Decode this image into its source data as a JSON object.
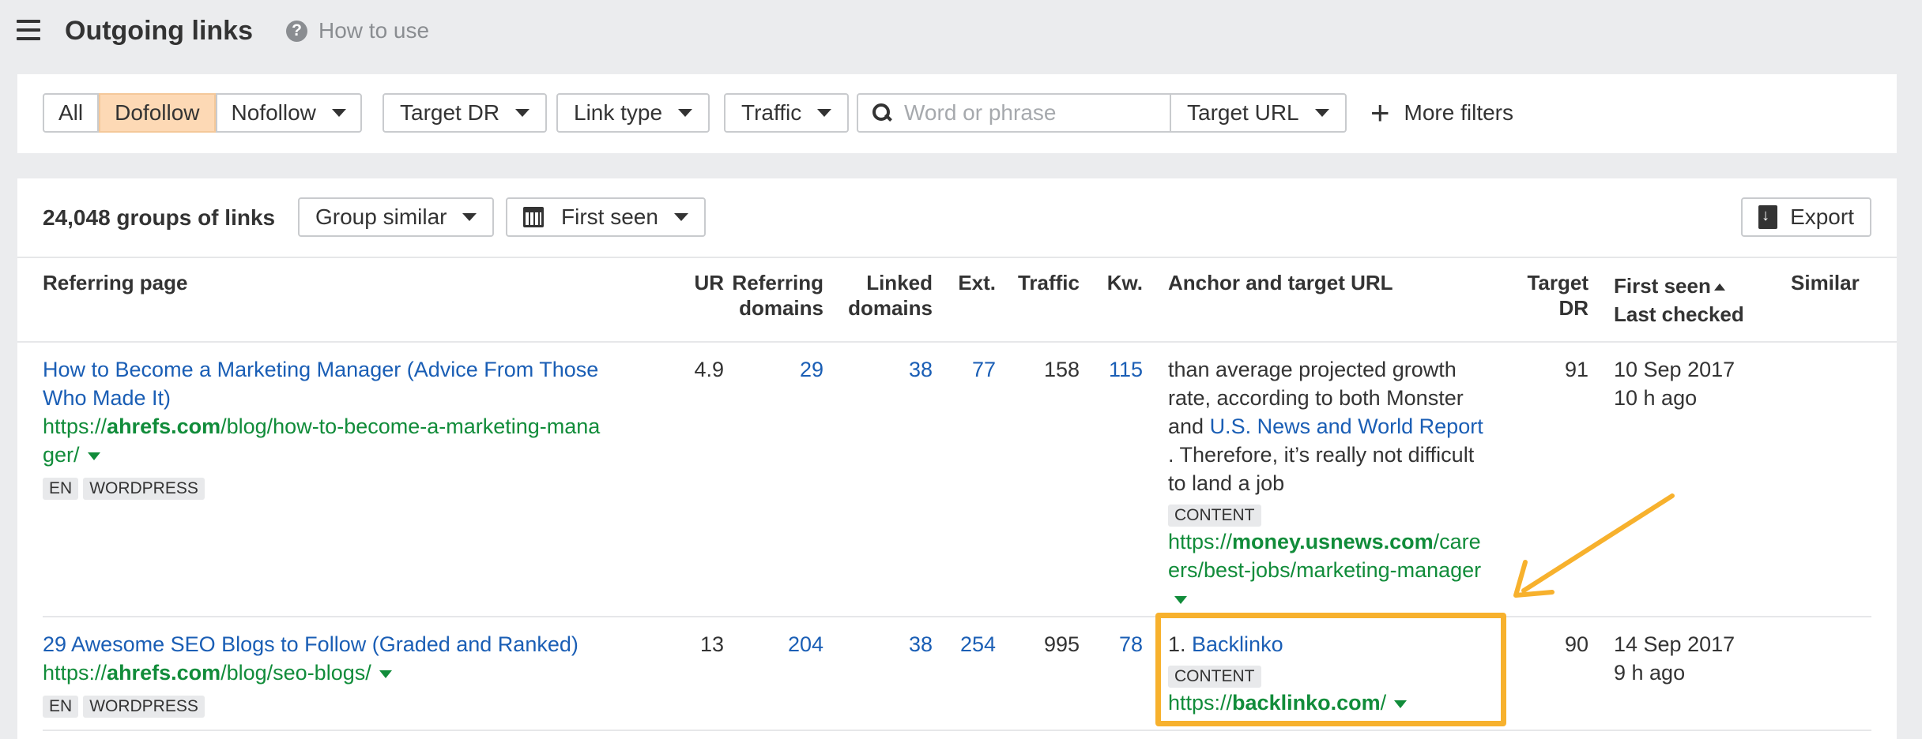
{
  "header": {
    "title": "Outgoing links",
    "howto_label": "How to use"
  },
  "filters": {
    "all": "All",
    "dofollow": "Dofollow",
    "nofollow": "Nofollow",
    "target_dr": "Target DR",
    "link_type": "Link type",
    "traffic": "Traffic",
    "search_placeholder": "Word or phrase",
    "target_url": "Target URL",
    "more_filters": "More filters"
  },
  "toolbar": {
    "groups_count": "24,048 groups of links",
    "group_similar": "Group similar",
    "first_seen": "First seen",
    "export": "Export"
  },
  "columns": {
    "referring_page": "Referring page",
    "ur": "UR",
    "referring_domains_1": "Referring",
    "referring_domains_2": "domains",
    "linked_domains_1": "Linked",
    "linked_domains_2": "domains",
    "ext": "Ext.",
    "traffic": "Traffic",
    "kw": "Kw.",
    "anchor": "Anchor and target URL",
    "target_dr_1": "Target",
    "target_dr_2": "DR",
    "first_seen": "First seen",
    "last_checked": "Last checked",
    "similar": "Similar"
  },
  "rows": [
    {
      "title_line1": "How to Become a Marketing Manager (Advice From Those",
      "title_line2": "Who Made It)",
      "url_prefix": "https://",
      "url_domain": "ahrefs.com",
      "url_path_line1": "/blog/how-to-become-a-marketing-mana",
      "url_path_line2": "ger/",
      "tags": [
        "EN",
        "WORDPRESS"
      ],
      "ur": "4.9",
      "referring_domains": "29",
      "linked_domains": "38",
      "ext": "77",
      "traffic": "158",
      "kw": "115",
      "anchor_line1": "than average projected growth",
      "anchor_line2": "rate, according to both Monster",
      "anchor_line3_pre": "and ",
      "anchor_link": "U.S. News and World Report",
      "anchor_line4": ". Therefore, it’s really not difficult",
      "anchor_line5": "to land a job",
      "anchor_tag": "CONTENT",
      "target_prefix": "https://",
      "target_domain": "money.usnews.com",
      "target_path_line1": "/care",
      "target_path_line2": "ers/best-jobs/marketing-manager",
      "target_dr": "91",
      "first_seen": "10 Sep 2017",
      "last_checked": "10 h ago"
    },
    {
      "title_line1": "29 Awesome SEO Blogs to Follow (Graded and Ranked)",
      "url_prefix": "https://",
      "url_domain": "ahrefs.com",
      "url_path_line1": "/blog/seo-blogs/",
      "tags": [
        "EN",
        "WORDPRESS"
      ],
      "ur": "13",
      "referring_domains": "204",
      "linked_domains": "38",
      "ext": "254",
      "traffic": "995",
      "kw": "78",
      "anchor_num": "1. ",
      "anchor_link": "Backlinko",
      "anchor_tag": "CONTENT",
      "target_prefix": "https://",
      "target_domain": "backlinko.com",
      "target_path_line1": "/",
      "target_dr": "90",
      "first_seen": "14 Sep 2017",
      "last_checked": "9 h ago"
    }
  ],
  "colors": {
    "link": "#1a5eb5",
    "url_green": "#118c3a",
    "active_filter": "#fdd9b5",
    "highlight": "#f7b12d"
  }
}
